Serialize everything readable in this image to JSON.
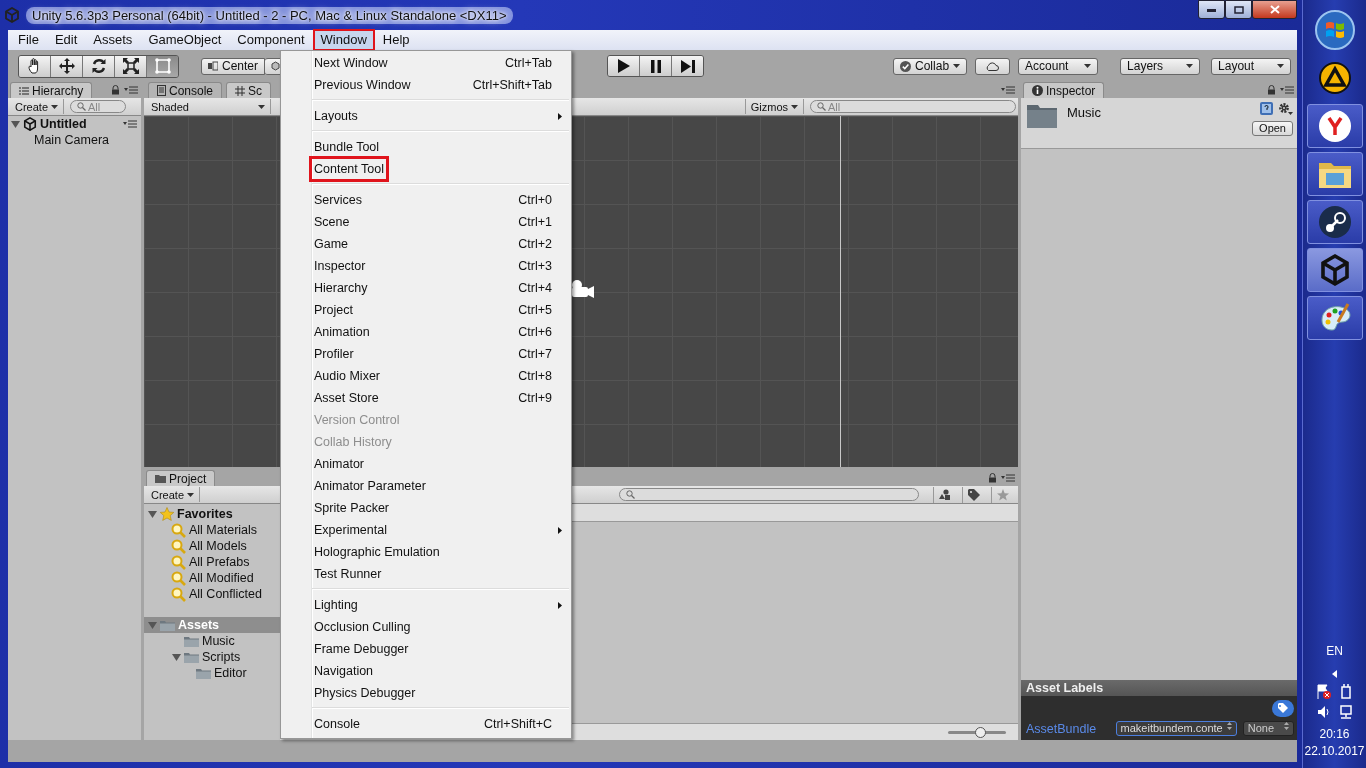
{
  "window": {
    "title": "Unity 5.6.3p3 Personal (64bit) - Untitled - 2 - PC, Mac & Linux Standalone <DX11>"
  },
  "menu_bar": [
    {
      "label": "File",
      "selected": false,
      "annotated": false
    },
    {
      "label": "Edit",
      "selected": false,
      "annotated": false
    },
    {
      "label": "Assets",
      "selected": false,
      "annotated": false
    },
    {
      "label": "GameObject",
      "selected": false,
      "annotated": false
    },
    {
      "label": "Component",
      "selected": false,
      "annotated": false
    },
    {
      "label": "Window",
      "selected": true,
      "annotated": true
    },
    {
      "label": "Help",
      "selected": false,
      "annotated": false
    }
  ],
  "toolbar": {
    "transform_tools": [
      {
        "kind": "hand",
        "selected": false
      },
      {
        "kind": "move",
        "selected": false
      },
      {
        "kind": "rotate",
        "selected": false
      },
      {
        "kind": "scale",
        "selected": false
      },
      {
        "kind": "rect",
        "selected": true
      }
    ],
    "pivot": "Center",
    "collab": "Collab",
    "account": "Account",
    "layers": "Layers",
    "layout": "Layout"
  },
  "hierarchy": {
    "tab": "Hierarchy",
    "create": "Create",
    "search_placeholder": "All",
    "scene": "Untitled",
    "items": [
      "Main Camera"
    ]
  },
  "scene_panel": {
    "tabs": [
      {
        "label": "Console",
        "kind": "console",
        "selected": false
      },
      {
        "label": "Sc",
        "kind": "scene",
        "selected": true
      }
    ],
    "shading": "Shaded",
    "gizmos": "Gizmos",
    "search_placeholder": "All"
  },
  "project": {
    "tab": "Project",
    "create": "Create",
    "favorites": {
      "label": "Favorites",
      "items": [
        "All Materials",
        "All Models",
        "All Prefabs",
        "All Modified",
        "All Conflicted"
      ]
    },
    "assets": {
      "label": "Assets",
      "selected": true,
      "expanded": true,
      "children": [
        {
          "label": "Music"
        },
        {
          "label": "Scripts",
          "expanded": true,
          "children": [
            {
              "label": "Editor"
            }
          ]
        }
      ]
    },
    "zoom_slider": {
      "level": 0.55
    }
  },
  "inspector": {
    "tab": "Inspector",
    "asset": "Music",
    "open": "Open",
    "labels_header": "Asset Labels",
    "bundle_label": "AssetBundle",
    "bundle_value": "makeitbundem.conte",
    "variant": "None"
  },
  "window_menu": [
    {
      "kind": "item",
      "label": "Next Window",
      "shortcut": "Ctrl+Tab",
      "disabled": false,
      "submenu": false,
      "annotated": false
    },
    {
      "kind": "item",
      "label": "Previous Window",
      "shortcut": "Ctrl+Shift+Tab",
      "disabled": false,
      "submenu": false,
      "annotated": false
    },
    {
      "kind": "separator"
    },
    {
      "kind": "item",
      "label": "Layouts",
      "disabled": false,
      "submenu": true,
      "annotated": false
    },
    {
      "kind": "separator"
    },
    {
      "kind": "item",
      "label": "Bundle Tool",
      "disabled": false,
      "submenu": false,
      "annotated": false
    },
    {
      "kind": "item",
      "label": "Content Tool",
      "disabled": false,
      "submenu": false,
      "annotated": true
    },
    {
      "kind": "separator"
    },
    {
      "kind": "item",
      "label": "Services",
      "shortcut": "Ctrl+0",
      "disabled": false,
      "submenu": false,
      "annotated": false
    },
    {
      "kind": "item",
      "label": "Scene",
      "shortcut": "Ctrl+1",
      "disabled": false,
      "submenu": false,
      "annotated": false
    },
    {
      "kind": "item",
      "label": "Game",
      "shortcut": "Ctrl+2",
      "disabled": false,
      "submenu": false,
      "annotated": false
    },
    {
      "kind": "item",
      "label": "Inspector",
      "shortcut": "Ctrl+3",
      "disabled": false,
      "submenu": false,
      "annotated": false
    },
    {
      "kind": "item",
      "label": "Hierarchy",
      "shortcut": "Ctrl+4",
      "disabled": false,
      "submenu": false,
      "annotated": false
    },
    {
      "kind": "item",
      "label": "Project",
      "shortcut": "Ctrl+5",
      "disabled": false,
      "submenu": false,
      "annotated": false
    },
    {
      "kind": "item",
      "label": "Animation",
      "shortcut": "Ctrl+6",
      "disabled": false,
      "submenu": false,
      "annotated": false
    },
    {
      "kind": "item",
      "label": "Profiler",
      "shortcut": "Ctrl+7",
      "disabled": false,
      "submenu": false,
      "annotated": false
    },
    {
      "kind": "item",
      "label": "Audio Mixer",
      "shortcut": "Ctrl+8",
      "disabled": false,
      "submenu": false,
      "annotated": false
    },
    {
      "kind": "item",
      "label": "Asset Store",
      "shortcut": "Ctrl+9",
      "disabled": false,
      "submenu": false,
      "annotated": false
    },
    {
      "kind": "item",
      "label": "Version Control",
      "disabled": true,
      "submenu": false,
      "annotated": false
    },
    {
      "kind": "item",
      "label": "Collab History",
      "disabled": true,
      "submenu": false,
      "annotated": false
    },
    {
      "kind": "item",
      "label": "Animator",
      "disabled": false,
      "submenu": false,
      "annotated": false
    },
    {
      "kind": "item",
      "label": "Animator Parameter",
      "disabled": false,
      "submenu": false,
      "annotated": false
    },
    {
      "kind": "item",
      "label": "Sprite Packer",
      "disabled": false,
      "submenu": false,
      "annotated": false
    },
    {
      "kind": "item",
      "label": "Experimental",
      "disabled": false,
      "submenu": true,
      "annotated": false
    },
    {
      "kind": "item",
      "label": "Holographic Emulation",
      "disabled": false,
      "submenu": false,
      "annotated": false
    },
    {
      "kind": "item",
      "label": "Test Runner",
      "disabled": false,
      "submenu": false,
      "annotated": false
    },
    {
      "kind": "separator"
    },
    {
      "kind": "item",
      "label": "Lighting",
      "disabled": false,
      "submenu": true,
      "annotated": false
    },
    {
      "kind": "item",
      "label": "Occlusion Culling",
      "disabled": false,
      "submenu": false,
      "annotated": false
    },
    {
      "kind": "item",
      "label": "Frame Debugger",
      "disabled": false,
      "submenu": false,
      "annotated": false
    },
    {
      "kind": "item",
      "label": "Navigation",
      "disabled": false,
      "submenu": false,
      "annotated": false
    },
    {
      "kind": "item",
      "label": "Physics Debugger",
      "disabled": false,
      "submenu": false,
      "annotated": false
    },
    {
      "kind": "separator"
    },
    {
      "kind": "item",
      "label": "Console",
      "shortcut": "Ctrl+Shift+C",
      "disabled": false,
      "submenu": false,
      "annotated": false
    }
  ],
  "taskbar": {
    "apps": [
      {
        "kind": "start"
      },
      {
        "kind": "aimp"
      },
      {
        "kind": "browser"
      },
      {
        "kind": "explorer"
      },
      {
        "kind": "steam"
      },
      {
        "kind": "unity"
      },
      {
        "kind": "paint"
      }
    ],
    "language": "EN",
    "time": "20:16",
    "date": "22.10.2017"
  }
}
